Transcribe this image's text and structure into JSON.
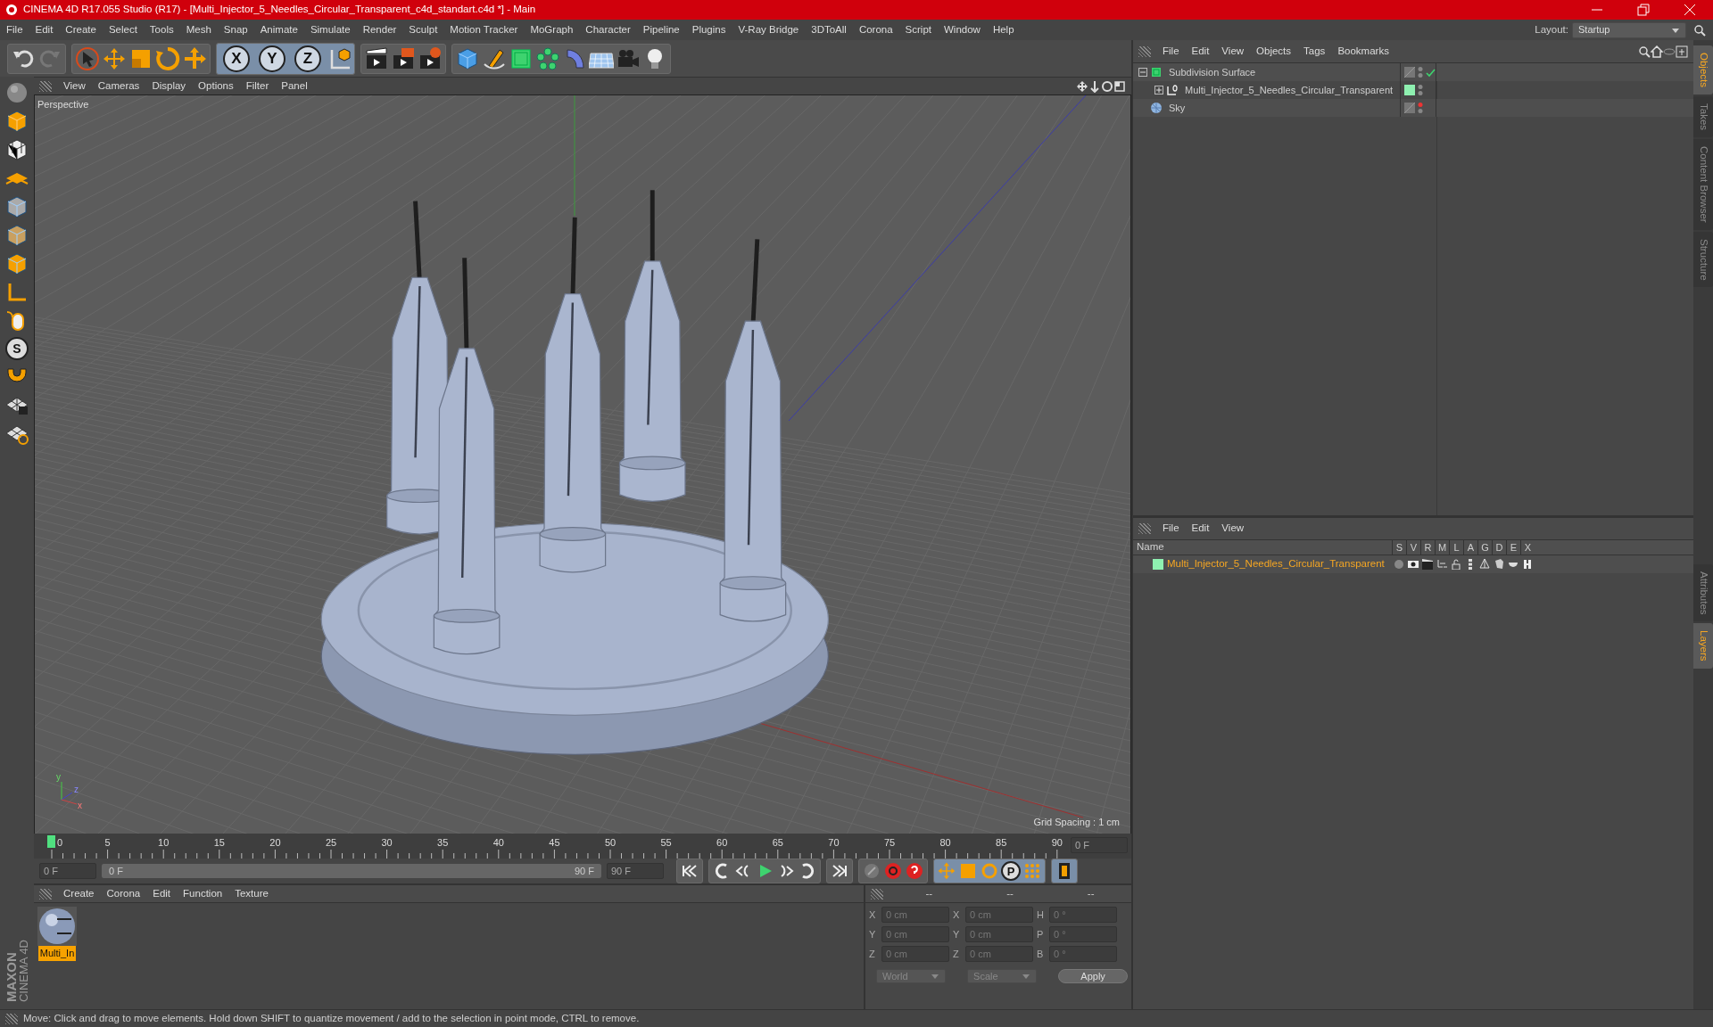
{
  "window": {
    "title": "CINEMA 4D R17.055 Studio (R17) - [Multi_Injector_5_Needles_Circular_Transparent_c4d_standart.c4d *] - Main"
  },
  "menu_bar": [
    "File",
    "Edit",
    "Create",
    "Select",
    "Tools",
    "Mesh",
    "Snap",
    "Animate",
    "Simulate",
    "Render",
    "Sculpt",
    "Motion Tracker",
    "MoGraph",
    "Character",
    "Pipeline",
    "Plugins",
    "V-Ray Bridge",
    "3DToAll",
    "Corona",
    "Script",
    "Window",
    "Help"
  ],
  "layout": {
    "label": "Layout:",
    "value": "Startup"
  },
  "toolbar": {
    "axis_buttons": [
      "X",
      "Y",
      "Z"
    ]
  },
  "left_tools": {
    "snap_label": "S"
  },
  "viewport": {
    "menu": [
      "View",
      "Cameras",
      "Display",
      "Options",
      "Filter",
      "Panel"
    ],
    "camera": "Perspective",
    "grid_spacing": "Grid Spacing : 1 cm",
    "axis_labels": [
      "y",
      "z",
      "x"
    ]
  },
  "object_manager": {
    "menu": [
      "File",
      "Edit",
      "View",
      "Objects",
      "Tags",
      "Bookmarks"
    ],
    "objects": [
      {
        "name": "Subdivision Surface",
        "kind": "subdivision",
        "expanded": true,
        "editor_visible": true,
        "checked": true,
        "children": [
          {
            "name": "Multi_Injector_5_Needles_Circular_Transparent",
            "kind": "null",
            "expanded": false,
            "color": "#8ef0b0",
            "editor_visible": true,
            "checked": false
          }
        ]
      },
      {
        "name": "Sky",
        "kind": "sky",
        "editor_visible": false,
        "checked": false
      }
    ]
  },
  "layers": {
    "menu": [
      "File",
      "Edit",
      "View"
    ],
    "columns": [
      "Name",
      "S",
      "V",
      "R",
      "M",
      "L",
      "A",
      "G",
      "D",
      "E",
      "X"
    ],
    "rows": [
      {
        "name": "Multi_Injector_5_Needles_Circular_Transparent",
        "color": "#8ef0b0",
        "selected": true
      }
    ]
  },
  "side_tabs_top": [
    {
      "label": "Objects",
      "selected": true
    },
    {
      "label": "Takes",
      "selected": false
    },
    {
      "label": "Content Browser",
      "selected": false
    },
    {
      "label": "Structure",
      "selected": false
    }
  ],
  "side_tabs_bottom": [
    {
      "label": "Attributes",
      "selected": false
    },
    {
      "label": "Layers",
      "selected": true
    }
  ],
  "timeline": {
    "ruler_labels": [
      "0",
      "5",
      "10",
      "15",
      "20",
      "25",
      "30",
      "35",
      "40",
      "45",
      "50",
      "55",
      "60",
      "65",
      "70",
      "75",
      "80",
      "85",
      "90"
    ],
    "level": 0,
    "current_frame": "0 F",
    "start_field": "0 F",
    "range": {
      "start": "0 F",
      "end": "90 F",
      "level": 1
    },
    "end_field": "90 F",
    "param_key_label": "P"
  },
  "material_manager": {
    "menu": [
      "Create",
      "Corona",
      "Edit",
      "Function",
      "Texture"
    ],
    "materials": [
      {
        "name": "Multi_In",
        "selected": true
      }
    ]
  },
  "coordinates": {
    "headers": [
      "--",
      "--",
      "--"
    ],
    "rows": [
      {
        "position_axis": "X",
        "position": "0 cm",
        "size_axis": "X",
        "size": "0 cm",
        "rotation_axis": "H",
        "rotation": "0 °"
      },
      {
        "position_axis": "Y",
        "position": "0 cm",
        "size_axis": "Y",
        "size": "0 cm",
        "rotation_axis": "P",
        "rotation": "0 °"
      },
      {
        "position_axis": "Z",
        "position": "0 cm",
        "size_axis": "Z",
        "size": "0 cm",
        "rotation_axis": "B",
        "rotation": "0 °"
      }
    ],
    "dropdowns": [
      "World",
      "Scale"
    ],
    "apply": "Apply"
  },
  "logo": {
    "brand": "MAXON",
    "product": "CINEMA 4D"
  },
  "status_bar": "Move: Click and drag to move elements. Hold down SHIFT to quantize movement / add to the selection in point mode, CTRL to remove."
}
